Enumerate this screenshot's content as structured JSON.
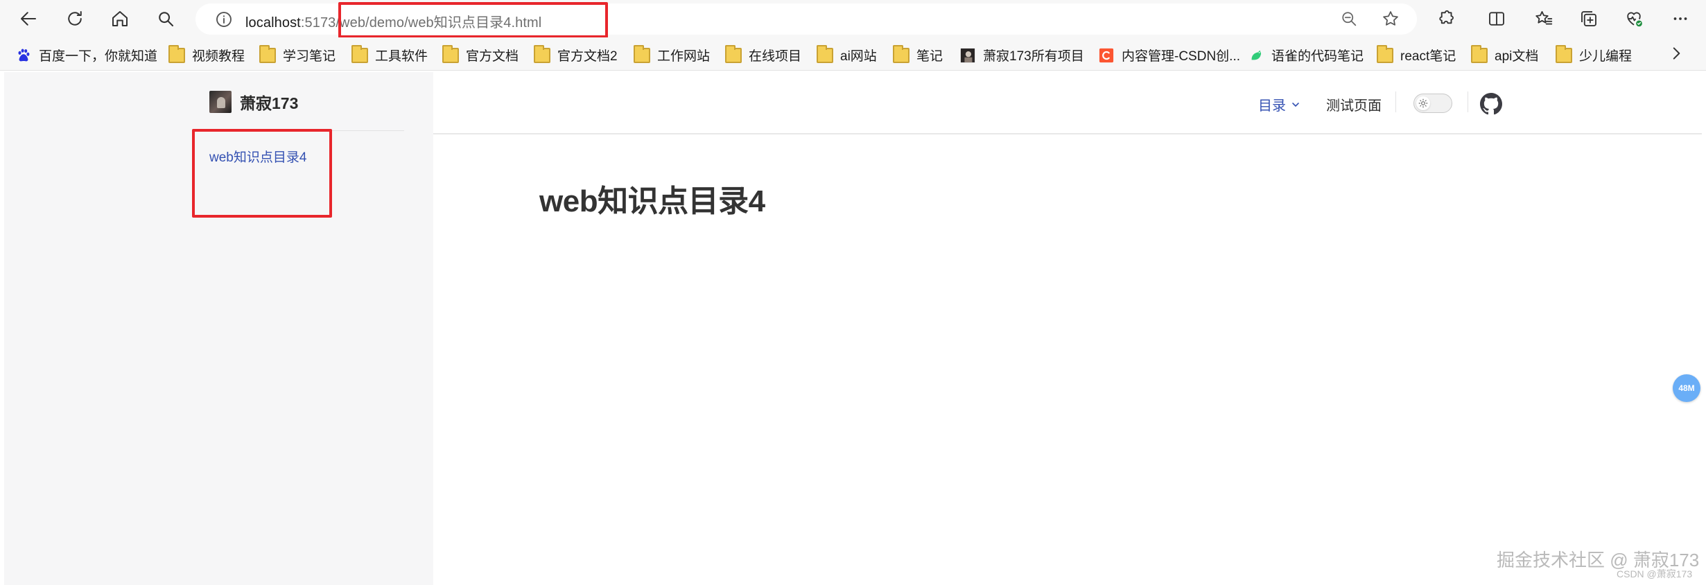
{
  "browser": {
    "url_host": "localhost",
    "url_rest": ":5173/web/demo/web知识点目录4.html",
    "icons": [
      "back-icon",
      "refresh-icon",
      "home-icon",
      "search-icon",
      "info-icon",
      "zoom-out-icon",
      "star-icon",
      "extensions-icon",
      "split-screen-icon",
      "favorites-icon",
      "collections-icon",
      "browser-essentials-icon",
      "more-icon"
    ]
  },
  "bookmarks": [
    {
      "label": "百度一下，你就知道",
      "icon": "baidu-icon"
    },
    {
      "label": "视频教程",
      "icon": "folder-icon"
    },
    {
      "label": "学习笔记",
      "icon": "folder-icon"
    },
    {
      "label": "工具软件",
      "icon": "folder-icon"
    },
    {
      "label": "官方文档",
      "icon": "folder-icon"
    },
    {
      "label": "官方文档2",
      "icon": "folder-icon"
    },
    {
      "label": "工作网站",
      "icon": "folder-icon"
    },
    {
      "label": "在线项目",
      "icon": "folder-icon"
    },
    {
      "label": "ai网站",
      "icon": "folder-icon"
    },
    {
      "label": "笔记",
      "icon": "folder-icon"
    },
    {
      "label": "萧寂173所有项目",
      "icon": "avatar-icon"
    },
    {
      "label": "内容管理-CSDN创...",
      "icon": "csdn-icon"
    },
    {
      "label": "语雀的代码笔记",
      "icon": "yuque-icon"
    },
    {
      "label": "react笔记",
      "icon": "folder-icon"
    },
    {
      "label": "api文档",
      "icon": "folder-icon"
    },
    {
      "label": "少儿编程",
      "icon": "folder-icon"
    }
  ],
  "site": {
    "brand_name": "萧寂173",
    "sidebar_link": "web知识点目录4",
    "nav_menu": "目录",
    "nav_test": "测试页面",
    "page_title": "web知识点目录4"
  },
  "overlay": {
    "memory_badge": "48M",
    "watermark_main": "掘金技术社区 @ 萧寂173",
    "watermark_sub": "CSDN @萧寂173"
  },
  "colors": {
    "accent": "#3451b2",
    "highlight_box": "#e8262c",
    "sidebar_bg": "#f6f6f7"
  }
}
